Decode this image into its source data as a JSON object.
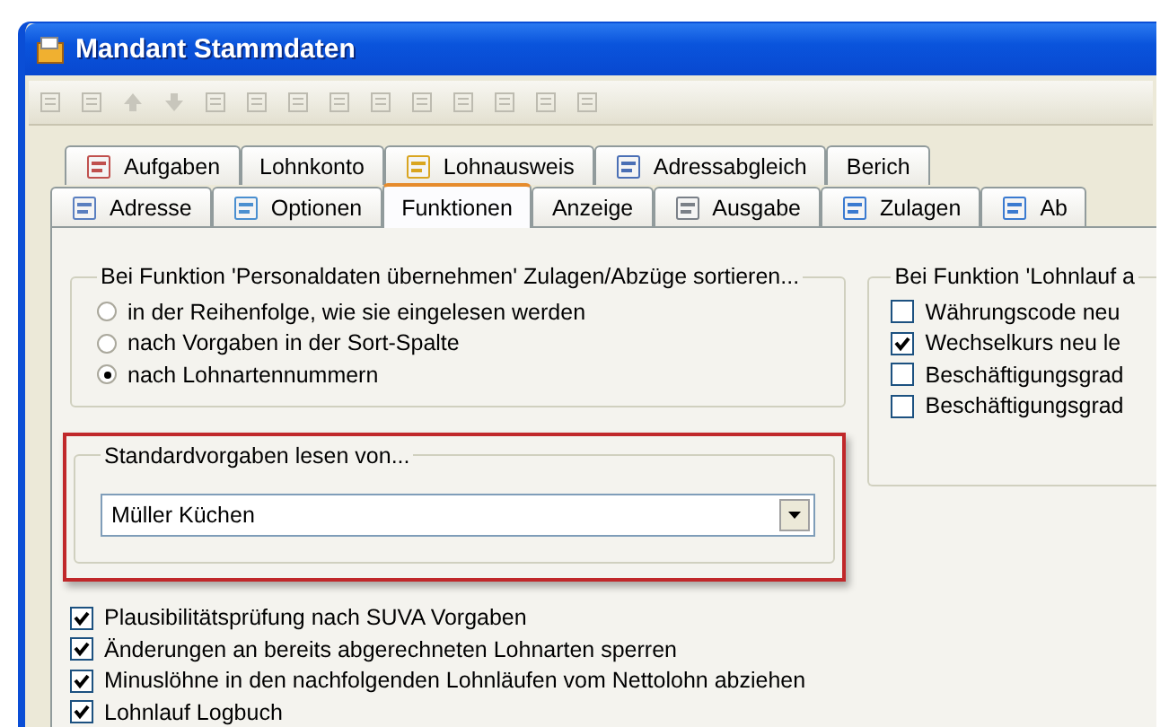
{
  "window": {
    "title": "Mandant Stammdaten"
  },
  "tabs_row_1": [
    {
      "label": "Aufgaben",
      "selected": false
    },
    {
      "label": "Lohnkonto",
      "selected": false
    },
    {
      "label": "Lohnausweis",
      "selected": false
    },
    {
      "label": "Adressabgleich",
      "selected": false
    },
    {
      "label": "Berich",
      "selected": false
    }
  ],
  "tabs_row_2": [
    {
      "label": "Adresse",
      "selected": false
    },
    {
      "label": "Optionen",
      "selected": false
    },
    {
      "label": "Funktionen",
      "selected": true
    },
    {
      "label": "Anzeige",
      "selected": false
    },
    {
      "label": "Ausgabe",
      "selected": false
    },
    {
      "label": "Zulagen",
      "selected": false
    },
    {
      "label": "Ab",
      "selected": false
    }
  ],
  "sort_group": {
    "title": "Bei Funktion 'Personaldaten übernehmen' Zulagen/Abzüge sortieren...",
    "options": [
      {
        "label": "in der Reihenfolge, wie sie eingelesen werden",
        "selected": false
      },
      {
        "label": "nach Vorgaben in der Sort-Spalte",
        "selected": false
      },
      {
        "label": "nach Lohnartennummern",
        "selected": true
      }
    ]
  },
  "defaults_group": {
    "title": "Standardvorgaben lesen von...",
    "value": "Müller Küchen"
  },
  "options": [
    {
      "label": "Plausibilitätsprüfung nach SUVA Vorgaben",
      "checked": true
    },
    {
      "label": "Änderungen an bereits abgerechneten Lohnarten sperren",
      "checked": true
    },
    {
      "label": "Minuslöhne in den nachfolgenden Lohnläufen vom Nettolohn abziehen",
      "checked": true
    },
    {
      "label": "Lohnlauf Logbuch",
      "checked": true
    }
  ],
  "payroll_group": {
    "title": "Bei Funktion 'Lohnlauf a",
    "options": [
      {
        "label": "Währungscode neu",
        "checked": false
      },
      {
        "label": "Wechselkurs neu le",
        "checked": true
      },
      {
        "label": "Beschäftigungsgrad",
        "checked": false
      },
      {
        "label": "Beschäftigungsgrad",
        "checked": false
      }
    ]
  }
}
